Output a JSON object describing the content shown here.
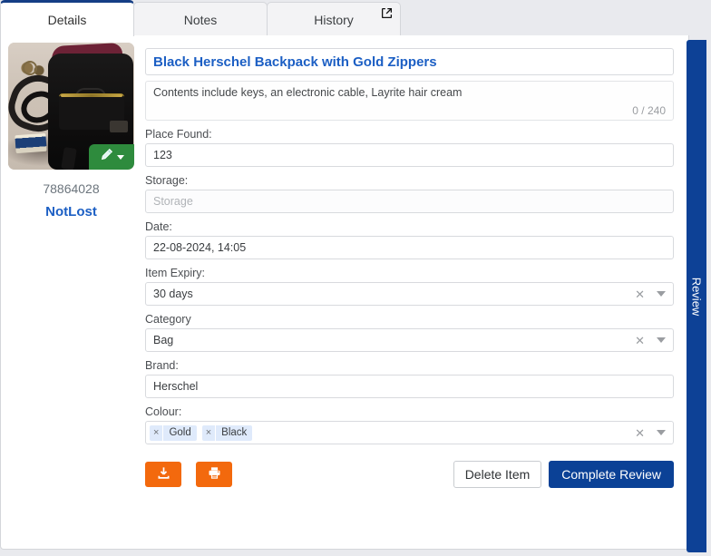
{
  "tabs": [
    {
      "label": "Details",
      "active": true
    },
    {
      "label": "Notes",
      "active": false
    },
    {
      "label": "History",
      "active": false
    }
  ],
  "popout_icon": "external-link-icon",
  "left_panel": {
    "photo_alt": "black backpack with keys, cable and hair cream tin",
    "edit_button_icon": "pencil-icon",
    "item_id": "78864028",
    "status": "NotLost"
  },
  "form": {
    "title": "Black Herschel Backpack with Gold Zippers",
    "description": "Contents include keys, an electronic cable, Layrite hair cream",
    "description_counter": "0 / 240",
    "fields": {
      "place_found_label": "Place Found:",
      "place_found_value": "123",
      "storage_label": "Storage:",
      "storage_placeholder": "Storage",
      "date_label": "Date:",
      "date_value": "22-08-2024, 14:05",
      "item_expiry_label": "Item Expiry:",
      "item_expiry_value": "30 days",
      "category_label": "Category",
      "category_value": "Bag",
      "brand_label": "Brand:",
      "brand_value": "Herschel",
      "colour_label": "Colour:",
      "colour_chips": [
        "Gold",
        "Black"
      ]
    }
  },
  "footer": {
    "download_icon": "download-icon",
    "print_icon": "print-icon",
    "delete_label": "Delete Item",
    "complete_label": "Complete Review"
  },
  "side_tab": {
    "label": "Review"
  },
  "colors": {
    "accent_blue": "#0b4196",
    "link_blue": "#1c5fc4",
    "orange": "#f3690d",
    "green": "#2e8b3d",
    "chip_bg": "#dfeafb"
  }
}
